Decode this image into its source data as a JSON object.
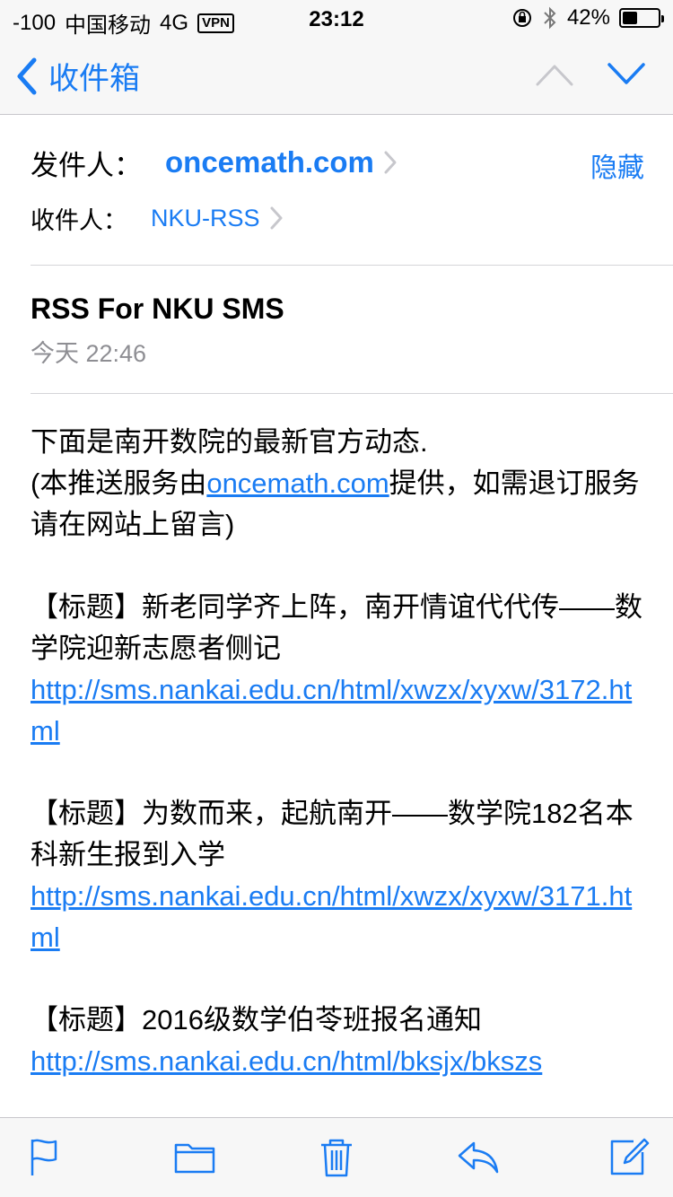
{
  "status_bar": {
    "signal": "-100",
    "carrier": "中国移动",
    "network": "4G",
    "vpn": "VPN",
    "time": "23:12",
    "battery_percent": "42%",
    "battery_level": 0.42
  },
  "nav": {
    "back_label": "收件箱",
    "prev_icon": "chevron-up-icon",
    "next_icon": "chevron-down-icon"
  },
  "header": {
    "from_label": "发件人：",
    "from_value": "oncemath.com",
    "to_label": "收件人：",
    "to_value": "NKU-RSS",
    "hide_label": "隐藏"
  },
  "message": {
    "subject": "RSS For NKU SMS",
    "date": "今天 22:46",
    "intro_before_link": "下面是南开数院的最新官方动态.",
    "intro_paren_open": "(本推送服务由",
    "intro_link": "oncemath.com",
    "intro_after_link": "提供，如需退订服务请在网站上留言)",
    "items": [
      {
        "title": "【标题】新老同学齐上阵，南开情谊代代传——数学院迎新志愿者侧记",
        "url": "http://sms.nankai.edu.cn/html/xwzx/xyxw/3172.html"
      },
      {
        "title": "【标题】为数而来，起航南开——数学院182名本科新生报到入学",
        "url": "http://sms.nankai.edu.cn/html/xwzx/xyxw/3171.html"
      },
      {
        "title": "【标题】2016级数学伯苓班报名通知",
        "url": "http://sms.nankai.edu.cn/html/bksjx/bkszs"
      }
    ]
  },
  "toolbar": {
    "icons": [
      "flag-icon",
      "folder-icon",
      "trash-icon",
      "reply-icon",
      "compose-icon"
    ]
  },
  "colors": {
    "accent": "#1a7cf3",
    "bar_bg": "#f7f7f7",
    "separator": "#d5d5d8",
    "secondary_text": "#8e8e93"
  }
}
